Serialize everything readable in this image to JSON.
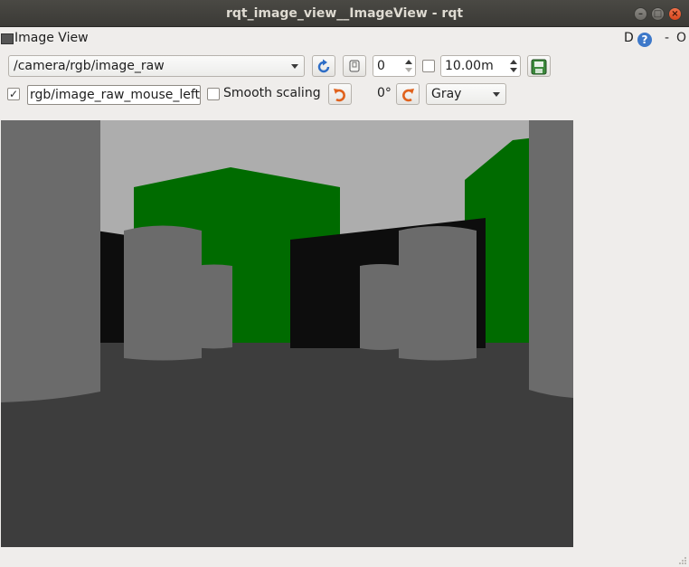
{
  "window": {
    "title": "rqt_image_view__ImageView - rqt"
  },
  "dock": {
    "title": "Image View",
    "d_label": "D",
    "help_label": "?",
    "minimize_label": "-",
    "float_label": "O"
  },
  "toolbar": {
    "topic": "/camera/rgb/image_raw",
    "number_value": "0",
    "max_range": "10.00m",
    "mouse_topic": "rgb/image_raw_mouse_left",
    "mouse_checked": true,
    "smooth_scaling_label": "Smooth scaling",
    "smooth_scaling_checked": false,
    "rotation_label": "0°",
    "color_scheme": "Gray"
  },
  "icons": {
    "refresh": "refresh-icon",
    "zoom": "zoom-icon",
    "save": "save-icon",
    "rotate_left": "rotate-left-icon",
    "rotate_right": "rotate-right-icon"
  },
  "colors": {
    "sky": "#adadad",
    "floor": "#3d3d3d",
    "pillar": "#6b6b6b",
    "wall_black": "#0d0d0d",
    "wall_green": "#006b00"
  }
}
